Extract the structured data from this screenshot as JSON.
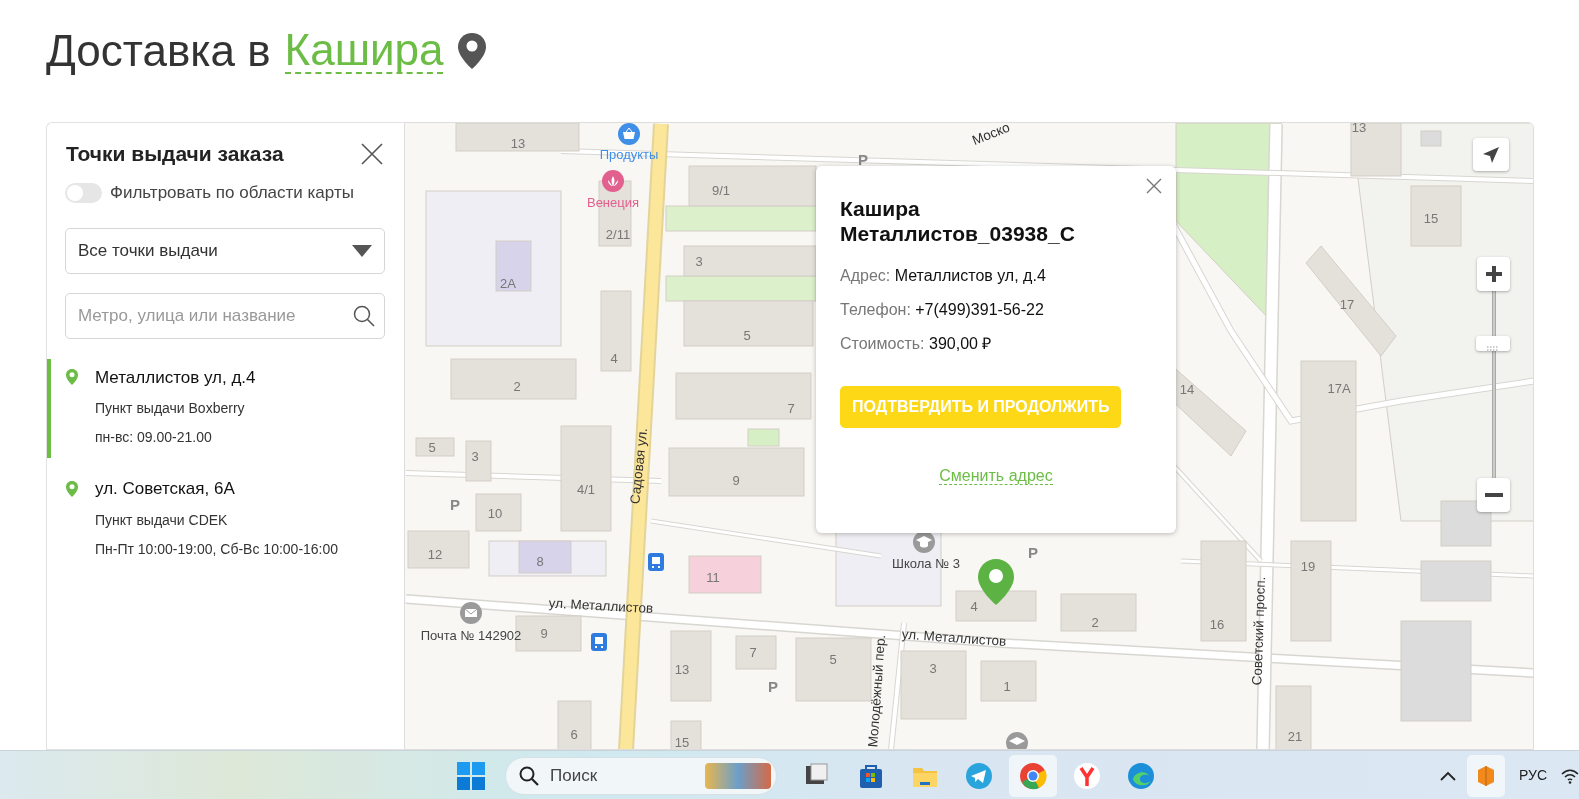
{
  "header": {
    "prefix": "Доставка в",
    "city": "Кашира"
  },
  "panel": {
    "title": "Точки выдачи заказа",
    "filter_toggle": {
      "label": "Фильтровать по области карты",
      "on": false
    },
    "type_select": {
      "value": "Все точки выдачи"
    },
    "search": {
      "placeholder": "Метро, улица или название"
    },
    "points": [
      {
        "address": "Металлистов ул, д.4",
        "provider": "Пункт выдачи Boxberry",
        "hours": "пн-вс: 09.00-21.00",
        "selected": true
      },
      {
        "address": "ул. Советская, 6А",
        "provider": "Пункт выдачи CDEK",
        "hours": "Пн-Пт 10:00-19:00, Сб-Вс 10:00-16:00",
        "selected": false
      }
    ]
  },
  "map": {
    "labels": [
      {
        "text": "13",
        "kind": "number"
      },
      {
        "text": "Продукты",
        "kind": "shop"
      },
      {
        "text": "Моско",
        "kind": "street"
      },
      {
        "text": "P",
        "kind": "parking"
      },
      {
        "text": "Венеция",
        "kind": "beauty"
      },
      {
        "text": "9/1",
        "kind": "number"
      },
      {
        "text": "2/11",
        "kind": "number"
      },
      {
        "text": "3",
        "kind": "number"
      },
      {
        "text": "2А",
        "kind": "number"
      },
      {
        "text": "5",
        "kind": "number"
      },
      {
        "text": "4",
        "kind": "number"
      },
      {
        "text": "2",
        "kind": "number"
      },
      {
        "text": "7",
        "kind": "number"
      },
      {
        "text": "5",
        "kind": "number"
      },
      {
        "text": "3",
        "kind": "number"
      },
      {
        "text": "Садовая ул.",
        "kind": "street"
      },
      {
        "text": "9",
        "kind": "number"
      },
      {
        "text": "4/1",
        "kind": "number"
      },
      {
        "text": "P",
        "kind": "parking"
      },
      {
        "text": "10",
        "kind": "number"
      },
      {
        "text": "12",
        "kind": "number"
      },
      {
        "text": "8",
        "kind": "number"
      },
      {
        "text": "11",
        "kind": "number"
      },
      {
        "text": "Школа № 3",
        "kind": "place"
      },
      {
        "text": "P",
        "kind": "parking"
      },
      {
        "text": "ул. Металлистов",
        "kind": "street"
      },
      {
        "text": "4",
        "kind": "number"
      },
      {
        "text": "Почта № 142902",
        "kind": "place"
      },
      {
        "text": "9",
        "kind": "number"
      },
      {
        "text": "ул. Металлистов",
        "kind": "street"
      },
      {
        "text": "2",
        "kind": "number"
      },
      {
        "text": "13",
        "kind": "number"
      },
      {
        "text": "7",
        "kind": "number"
      },
      {
        "text": "5",
        "kind": "number"
      },
      {
        "text": "3",
        "kind": "number"
      },
      {
        "text": "P",
        "kind": "parking"
      },
      {
        "text": "1",
        "kind": "number"
      },
      {
        "text": "Молодёжный пер.",
        "kind": "street"
      },
      {
        "text": "6",
        "kind": "number"
      },
      {
        "text": "15",
        "kind": "number"
      },
      {
        "text": "Советский просп.",
        "kind": "street"
      },
      {
        "text": "13",
        "kind": "number"
      },
      {
        "text": "15",
        "kind": "number"
      },
      {
        "text": "17",
        "kind": "number"
      },
      {
        "text": "14",
        "kind": "number"
      },
      {
        "text": "17А",
        "kind": "number"
      },
      {
        "text": "16",
        "kind": "number"
      },
      {
        "text": "19",
        "kind": "number"
      },
      {
        "text": "21",
        "kind": "number"
      }
    ],
    "zoom": {
      "level": 0.72
    },
    "popup": {
      "title": "Кашира Металлистов_03938_С",
      "fields": [
        {
          "label": "Адрес:",
          "value": "Металлистов ул, д.4"
        },
        {
          "label": "Телефон:",
          "value": "+7(499)391-56-22"
        },
        {
          "label": "Стоимость:",
          "value": "390,00 ₽"
        }
      ],
      "confirm_button": "ПОДТВЕРДИТЬ И ПРОДОЛЖИТЬ",
      "change_link": "Сменить адрес"
    }
  },
  "taskbar": {
    "search_placeholder": "Поиск",
    "language": "РУС",
    "apps": [
      {
        "kind": "window",
        "selected": false
      },
      {
        "kind": "store",
        "selected": false
      },
      {
        "kind": "folder",
        "selected": false
      },
      {
        "kind": "plane",
        "selected": false
      },
      {
        "kind": "ring",
        "selected": true
      },
      {
        "kind": "letter",
        "selected": false
      },
      {
        "kind": "wave",
        "selected": false
      }
    ],
    "tray_app": {
      "selected": true
    }
  }
}
